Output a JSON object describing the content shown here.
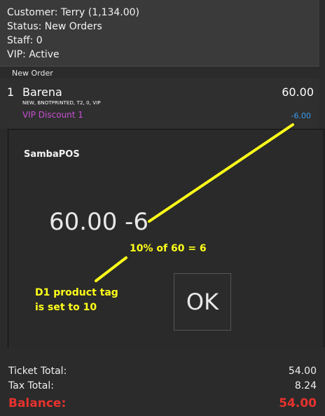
{
  "customer": {
    "customer_line": "Customer: Terry (1,134.00)",
    "status_line": "Status: New Orders",
    "staff_line": "Staff: 0",
    "vip_line": "VIP: Active"
  },
  "order_section": {
    "header": "New Order",
    "order": {
      "quantity": "1",
      "name": "Barena",
      "price": "60.00",
      "tags": "NEW, BNOTPRINTED, T2, 0, VIP",
      "discount_name": "VIP Discount 1",
      "discount_value": "-6.00"
    }
  },
  "dialog": {
    "title": "SambaPOS",
    "value": "60.00 -6",
    "ok_label": "OK"
  },
  "annotations": {
    "calc_note": "10% of 60 = 6",
    "tag_note_line1": "D1 product tag",
    "tag_note_line2": "is set to 10"
  },
  "totals": {
    "ticket_total_label": "Ticket Total:",
    "ticket_total_value": "54.00",
    "tax_total_label": "Tax Total:",
    "tax_total_value": "8.24",
    "balance_label": "Balance:",
    "balance_value": "54.00"
  },
  "colors": {
    "background": "#2b2b2b",
    "discount_name": "#c84fd4",
    "discount_value": "#3a9cf0",
    "annotation": "#ffff1a",
    "balance": "#e8322e"
  }
}
